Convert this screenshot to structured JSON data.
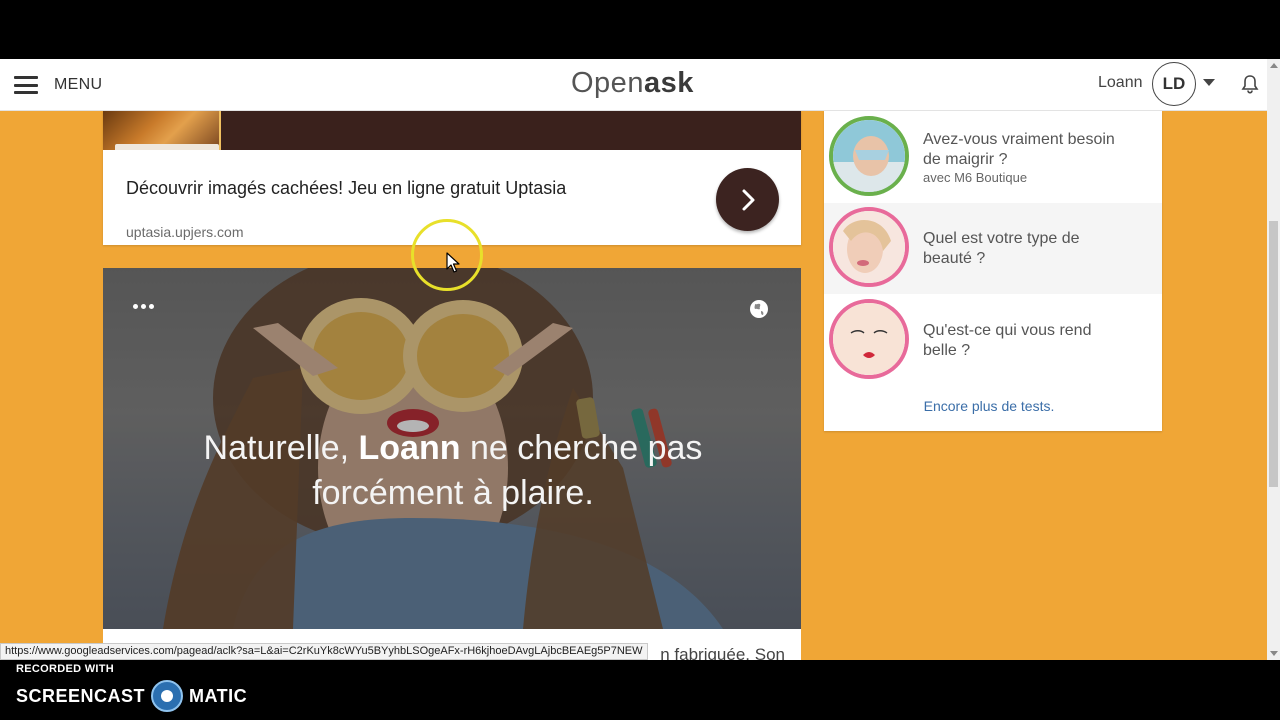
{
  "header": {
    "menu_label": "MENU",
    "logo_prefix": "Open",
    "logo_suffix": "ask",
    "user_name": "Loann",
    "avatar_initials": "LD"
  },
  "ad": {
    "title": "Découvrir imagés cachées! Jeu en ligne gratuit Uptasia",
    "url": "uptasia.upjers.com"
  },
  "hero": {
    "text_before": "Naturelle, ",
    "text_name": "Loann",
    "text_after": " ne cherche pas forcément à plaire.",
    "below_text": "n fabriquée. Son"
  },
  "sidebar": {
    "quizzes": [
      {
        "title": "Avez-vous vraiment besoin de maigrir ?",
        "subtitle": "avec M6 Boutique"
      },
      {
        "title": "Quel est votre type de beauté ?",
        "subtitle": ""
      },
      {
        "title": "Qu'est-ce qui vous rend belle ?",
        "subtitle": ""
      }
    ],
    "more_link": "Encore plus de tests."
  },
  "status_url": "https://www.googleadservices.com/pagead/aclk?sa=L&ai=C2rKuYk8cWYu5BYyhbLSOgeAFx-rH6kjhoeDAvgLAjbcBEAEg5P7NEW",
  "recorder": {
    "line1": "RECORDED WITH",
    "brand_left": "SCREENCAST",
    "brand_right": "MATIC"
  },
  "colors": {
    "page_background": "#f0a636",
    "ad_arrow": "#3c2320",
    "link": "#3b6ea8",
    "quiz_ring_green": "#6ab04c",
    "quiz_ring_pink": "#e86a9a"
  }
}
